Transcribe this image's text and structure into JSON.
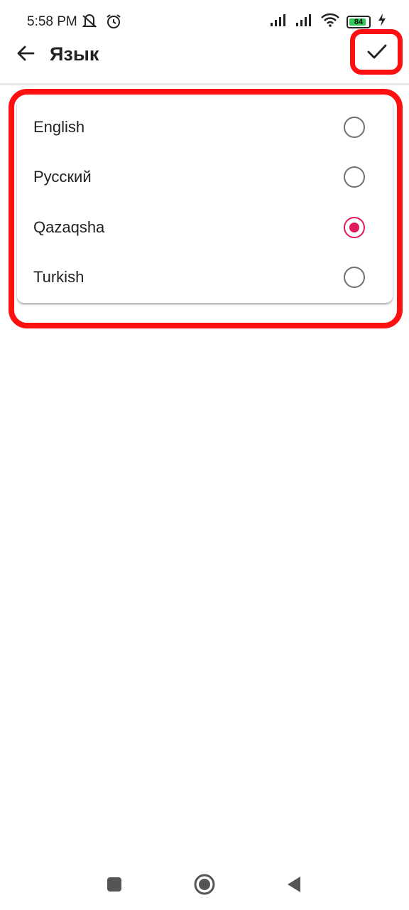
{
  "status_bar": {
    "time": "5:58 PM",
    "left_icons": [
      "vibrate-off-icon",
      "alarm-icon"
    ],
    "right_icons": [
      "signal-icon",
      "signal-icon",
      "wifi-icon",
      "battery-icon",
      "charging-icon"
    ],
    "battery_level": "84"
  },
  "app_bar": {
    "title": "Язык",
    "back_icon": "arrow-left-icon",
    "confirm_icon": "checkmark-icon"
  },
  "languages": [
    {
      "label": "English",
      "selected": false
    },
    {
      "label": "Русский",
      "selected": false
    },
    {
      "label": "Qazaqsha",
      "selected": true
    },
    {
      "label": "Turkish",
      "selected": false
    }
  ],
  "nav_bar": {
    "icons": [
      "recents-square-icon",
      "home-circle-icon",
      "back-triangle-icon"
    ]
  },
  "colors": {
    "accent": "#e0185d",
    "highlight": "#ff1010",
    "battery_fill": "#34c759"
  }
}
